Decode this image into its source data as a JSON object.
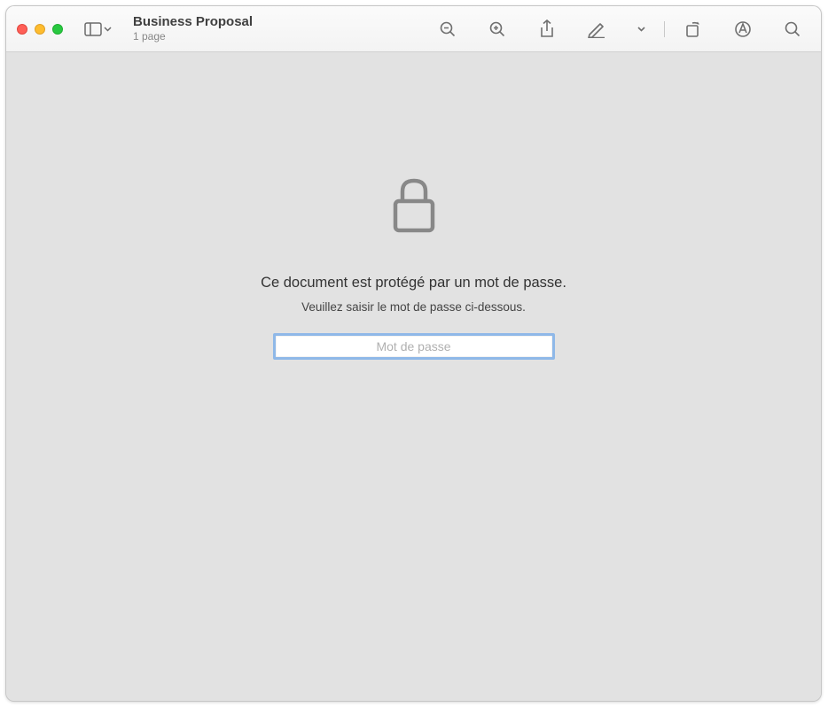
{
  "window": {
    "title": "Business Proposal",
    "subtitle": "1 page"
  },
  "content": {
    "message_main": "Ce document est protégé par un mot de passe.",
    "message_sub": "Veuillez saisir le mot de passe ci-dessous.",
    "password_placeholder": "Mot de passe",
    "password_value": ""
  }
}
